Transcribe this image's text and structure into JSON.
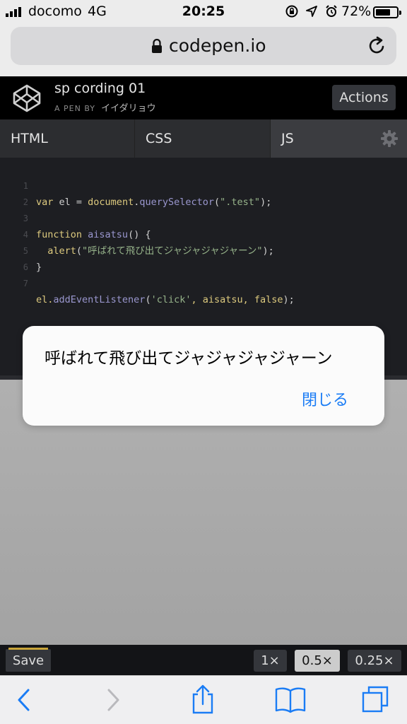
{
  "status_bar": {
    "carrier": "docomo",
    "network": "4G",
    "time": "20:25",
    "battery": "72%",
    "battery_level": 0.72
  },
  "browser": {
    "url": "codepen.io"
  },
  "codepen": {
    "pen_title": "sp cording 01",
    "pen_by_label": "A PEN BY",
    "author": "イイダリョウ",
    "actions_label": "Actions",
    "tabs": [
      {
        "label": "HTML"
      },
      {
        "label": "CSS"
      },
      {
        "label": "JS"
      }
    ],
    "line_numbers": [
      "1",
      "2",
      "3",
      "4",
      "5",
      "6",
      "7"
    ],
    "code": {
      "l1_var": "var",
      "l1_name": " el = ",
      "l1_doc": "document",
      "l1_dot": ".",
      "l1_method": "querySelector",
      "l1_open": "(",
      "l1_str": "\".test\"",
      "l1_close": ");",
      "l3_kw": "function",
      "l3_fn": " aisatsu",
      "l3_rest": "() {",
      "l4_fn": "  alert",
      "l4_open": "(",
      "l4_str": "\"呼ばれて飛び出てジャジャジャジャーン\"",
      "l4_close": ");",
      "l5": "}",
      "l7_obj": "el.",
      "l7_method": "addEventListener",
      "l7_open": "(",
      "l7_str": "'click'",
      "l7_mid": ", aisatsu, ",
      "l7_false": "false",
      "l7_close": ");"
    },
    "save_label": "Save",
    "zoom_options": [
      "1×",
      "0.5×",
      "0.25×"
    ],
    "selected_zoom": "0.5×"
  },
  "alert": {
    "message": "呼ばれて飛び出てジャジャジャジャーン",
    "button_label": "閉じる"
  },
  "toolbar_icons": [
    "back-icon",
    "forward-icon",
    "share-icon",
    "bookmarks-icon",
    "tabs-icon"
  ]
}
